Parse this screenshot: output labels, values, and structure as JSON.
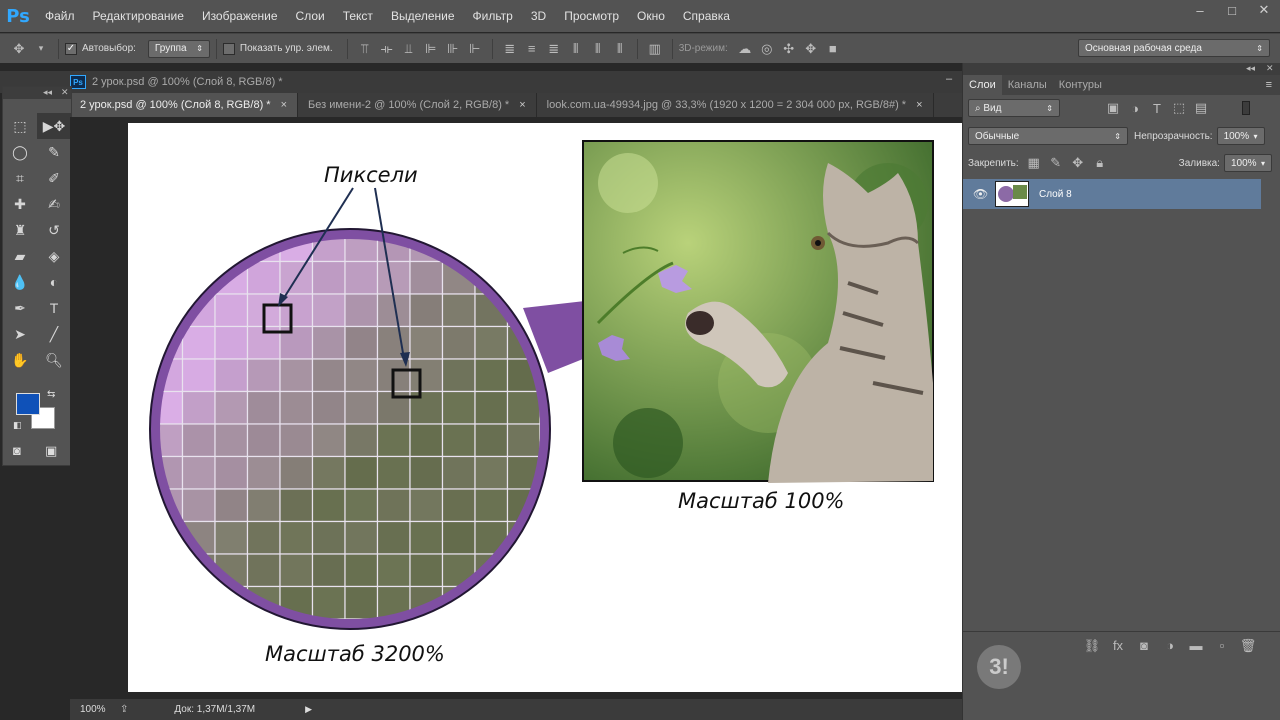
{
  "menubar": {
    "logo": "Ps",
    "items": [
      "Файл",
      "Редактирование",
      "Изображение",
      "Слои",
      "Текст",
      "Выделение",
      "Фильтр",
      "3D",
      "Просмотр",
      "Окно",
      "Справка"
    ],
    "minimize": "–",
    "maximize": "□",
    "close": "✕"
  },
  "options": {
    "autoselect_label": "Автовыбор:",
    "autoselect_value": "Группа",
    "show_controls_label": "Показать упр. элем.",
    "mode_3d_label": "3D-режим:",
    "workspace": "Основная рабочая среда"
  },
  "panel_strip": {
    "title": "2 урок.psd @ 100% (Слой 8, RGB/8) *"
  },
  "tabs": [
    {
      "label": "2 урок.psd @ 100% (Слой 8, RGB/8) *",
      "close": "×",
      "active": true
    },
    {
      "label": "Без имени-2 @ 100% (Слой 2, RGB/8) *",
      "close": "×",
      "active": false
    },
    {
      "label": "look.com.ua-49934.jpg @ 33,3% (1920 x 1200 = 2 304 000 px, RGB/8#) *",
      "close": "×",
      "active": false
    }
  ],
  "document": {
    "pixels_label": "Пиксели",
    "zoom_small_label": "Масштаб 3200%",
    "zoom_large_label": "Масштаб 100%"
  },
  "status": {
    "zoom": "100%",
    "doc": "Док: 1,37M/1,37M"
  },
  "layers_panel": {
    "tabs": [
      "Слои",
      "Каналы",
      "Контуры"
    ],
    "filter_value": "Вид",
    "blend_mode": "Обычные",
    "opacity_label": "Непрозрачность:",
    "opacity_value": "100%",
    "lock_label": "Закрепить:",
    "fill_label": "Заливка:",
    "fill_value": "100%",
    "layers": [
      {
        "name": "Слой 8",
        "visible": true
      }
    ]
  },
  "colors": {
    "foreground": "#0f51b8",
    "background": "#ffffff",
    "accent": "#31a8ff",
    "selected_layer": "#607b9b"
  }
}
